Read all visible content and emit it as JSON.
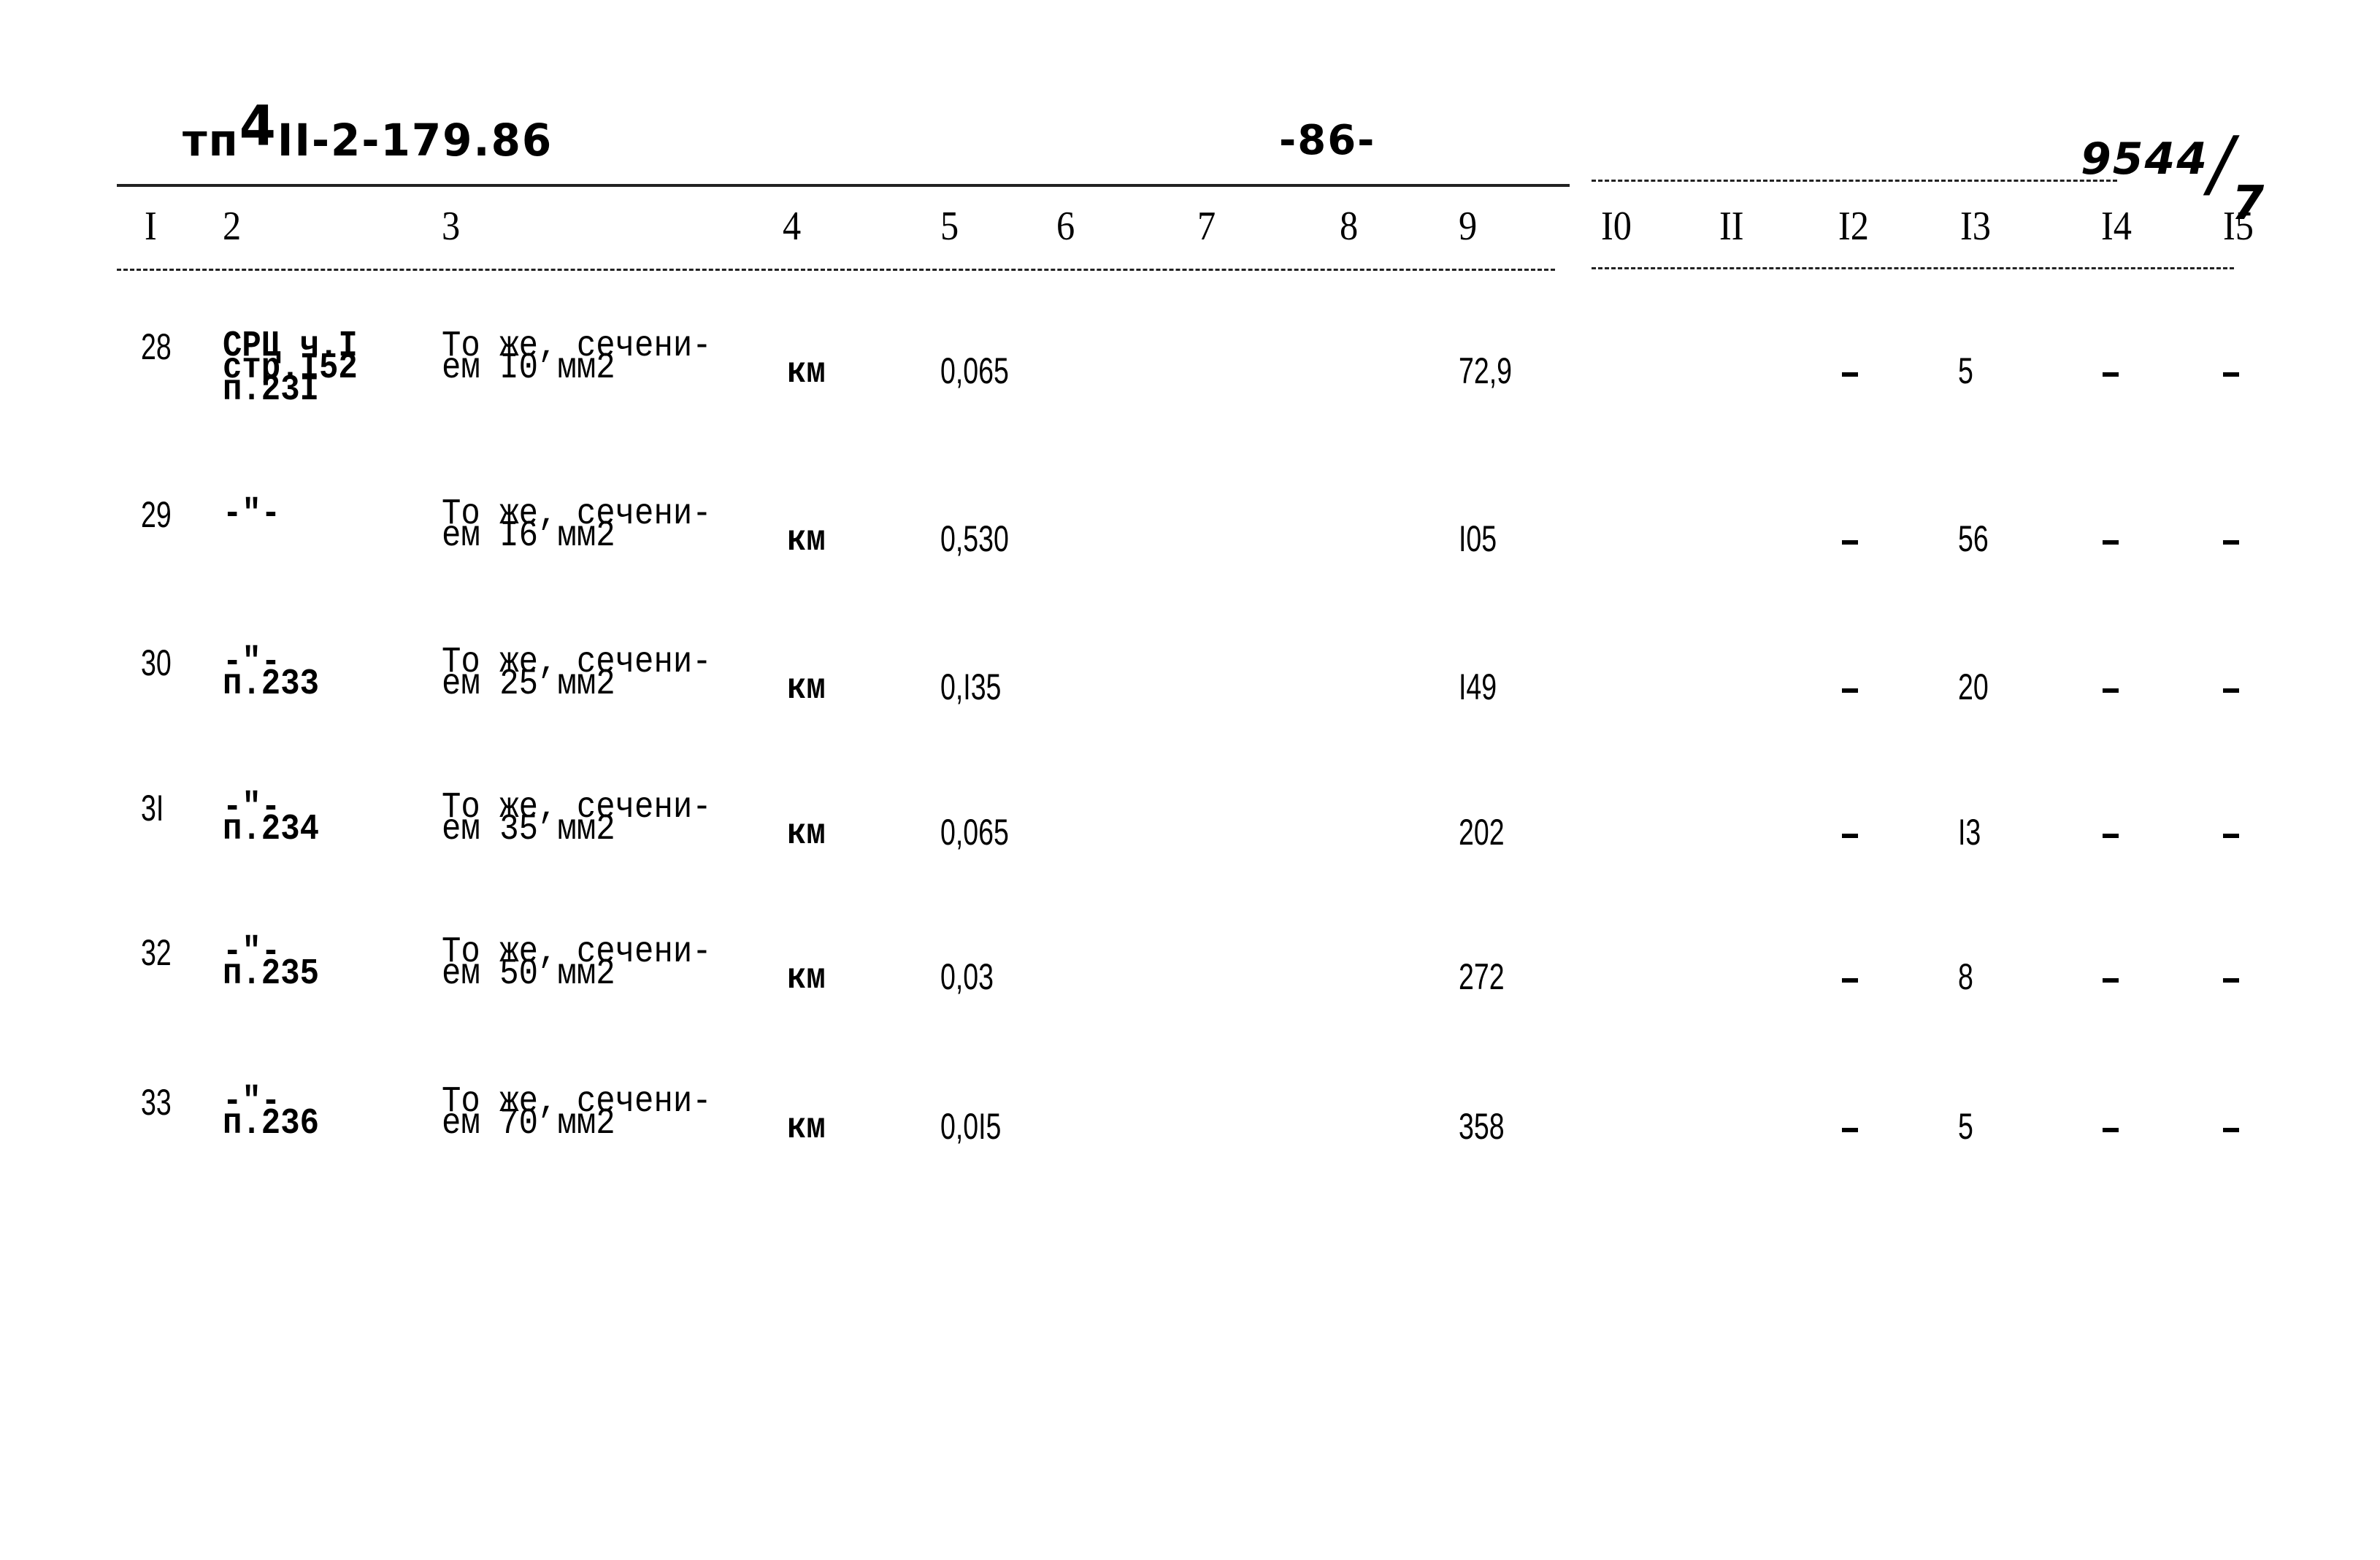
{
  "header": {
    "doc_code_prefix": "тп",
    "doc_code_sup": "4",
    "doc_code_rest": "II-2-179.86",
    "page_number": "-86-",
    "sheet_id_main": "9544",
    "sheet_id_slash": "/",
    "sheet_id_sub": "7"
  },
  "columns": [
    "I",
    "2",
    "3",
    "4",
    "5",
    "6",
    "7",
    "8",
    "9",
    "I0",
    "II",
    "I2",
    "I3",
    "I4",
    "I5"
  ],
  "rows": [
    {
      "no": "28",
      "ref": [
        "СРЦ ч.I",
        "стр.I52",
        "п.23I"
      ],
      "desc": [
        "То же, сечени-",
        "ем I0 мм2"
      ],
      "unit": "км",
      "col5": "0,065",
      "col9": "72,9",
      "col12": "-",
      "col13": "5",
      "col14": "-",
      "col15": "-"
    },
    {
      "no": "29",
      "ref": [
        "-\"-"
      ],
      "desc": [
        "То же, сечени-",
        "ем I6 мм2"
      ],
      "unit": "км",
      "col5": "0,530",
      "col9": "I05",
      "col12": "-",
      "col13": "56",
      "col14": "-",
      "col15": "-"
    },
    {
      "no": "30",
      "ref": [
        "-\"-",
        "п.233"
      ],
      "desc": [
        "То же, сечени-",
        "ем 25 мм2"
      ],
      "unit": "км",
      "col5": "0,I35",
      "col9": "I49",
      "col12": "-",
      "col13": "20",
      "col14": "-",
      "col15": "-"
    },
    {
      "no": "3I",
      "ref": [
        "-\"-",
        "п.234"
      ],
      "desc": [
        "То же, сечени-",
        "ем 35 мм2"
      ],
      "unit": "км",
      "col5": "0,065",
      "col9": "202",
      "col12": "-",
      "col13": "I3",
      "col14": "-",
      "col15": "-"
    },
    {
      "no": "32",
      "ref": [
        "-\"-",
        "п.235"
      ],
      "desc": [
        "То же, сечени-",
        "ем 50 мм2"
      ],
      "unit": "км",
      "col5": "0,03",
      "col9": "272",
      "col12": "-",
      "col13": "8",
      "col14": "-",
      "col15": "-"
    },
    {
      "no": "33",
      "ref": [
        "-\"-",
        "п.236"
      ],
      "desc": [
        "То же, сечени-",
        "ем 70 мм2"
      ],
      "unit": "км",
      "col5": "0,0I5",
      "col9": "358",
      "col12": "-",
      "col13": "5",
      "col14": "-",
      "col15": "-"
    }
  ]
}
